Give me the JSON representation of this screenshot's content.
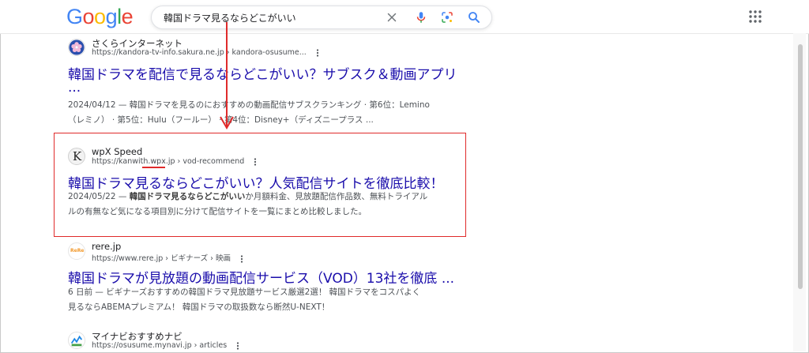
{
  "header": {
    "logo_letters": [
      "G",
      "o",
      "o",
      "g",
      "l",
      "e"
    ],
    "logo_colors": [
      "#4285F4",
      "#EA4335",
      "#FBBC05",
      "#4285F4",
      "#34A853",
      "#EA4335"
    ],
    "query": "韓国ドラマ見るならどこがいい"
  },
  "results": [
    {
      "site": "さくらインターネット",
      "url": "https://kandora-tv-info.sakura.ne.jp › kandora-osusume...",
      "title_line1": "韓国ドラマを配信で見るならどこがいい？サブスク＆動画アプリ",
      "title_line2": "...",
      "snippet_line1": "2024/04/12 — 韓国ドラマを見るのにおすすめの動画配信サブスクランキング · 第6位：Lemino",
      "snippet_line2": "（レミノ） · 第5位：Hulu（フールー） · 第4位：Disney+（ディズニープラス ..."
    },
    {
      "site": "wpX Speed",
      "url_prefix": "https://kanwith.",
      "url_highlight": "wpx.jp",
      "url_suffix": " › vod-recommend",
      "favicon_letter": "K",
      "title": "韓国ドラマ見るならどこがいい？人気配信サイトを徹底比較！",
      "snippet_date": "2024/05/22 — ",
      "snippet_bold": "韓国ドラマ見るならどこがいい",
      "snippet_rest": "か月額料金、見放題配信作品数、無料トライアル",
      "snippet_line2": "ルの有無など気になる項目別に分けて配信サイトを一覧にまとめ比較しました。"
    },
    {
      "site": "rere.jp",
      "url": "https://www.rere.jp › ビギナーズ › 映画",
      "favicon_text": "ReRe",
      "title": "韓国ドラマが見放題の動画配信サービス（VOD）13社を徹底 ...",
      "snippet_line1": "6 日前 — ビギナーズおすすめの韓国ドラマ見放題サービス厳選2選！ 韓国ドラマをコスパよく",
      "snippet_line2": "見るならABEMAプレミアム！ 韓国ドラマの取扱数なら断然U-NEXT！"
    },
    {
      "site": "マイナビおすすめナビ",
      "url": "https://osusume.mynavi.jp › articles"
    }
  ],
  "colors": {
    "link": "#1a0dab",
    "annotation": "#e02b2b"
  }
}
